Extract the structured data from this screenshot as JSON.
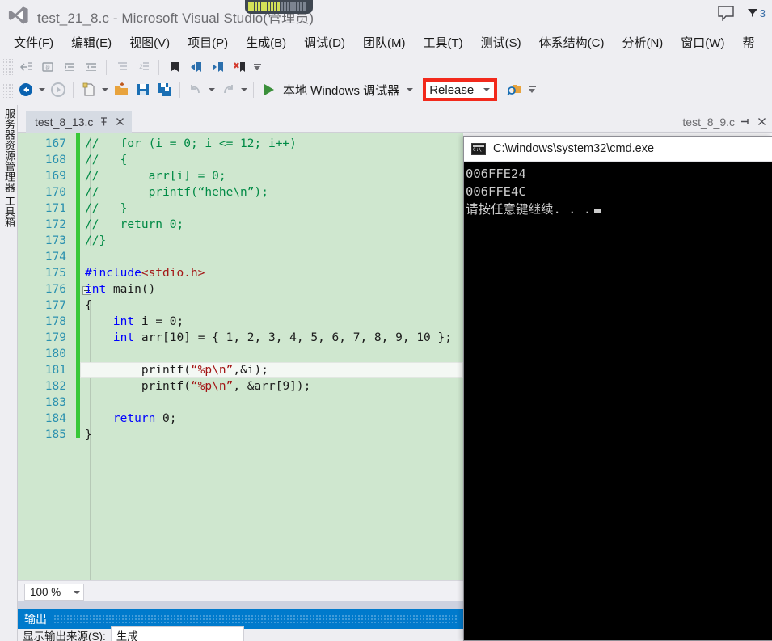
{
  "window": {
    "title": "test_21_8.c - Microsoft Visual Studio(管理员)",
    "logo_icon": "visual-studio-logo",
    "feedback_icon": "feedback-bubble-icon",
    "flag_icon": "flag-icon",
    "flag_count": "3"
  },
  "menubar": {
    "items": [
      {
        "label": "文件(F)"
      },
      {
        "label": "编辑(E)"
      },
      {
        "label": "视图(V)"
      },
      {
        "label": "项目(P)"
      },
      {
        "label": "生成(B)"
      },
      {
        "label": "调试(D)"
      },
      {
        "label": "团队(M)"
      },
      {
        "label": "工具(T)"
      },
      {
        "label": "测试(S)"
      },
      {
        "label": "体系结构(C)"
      },
      {
        "label": "分析(N)"
      },
      {
        "label": "窗口(W)"
      },
      {
        "label": "帮"
      }
    ]
  },
  "toolbar": {
    "run_label": "本地 Windows 调试器",
    "play_icon": "play-triangle-icon",
    "configuration": {
      "value": "Release",
      "highlight_color": "#f2291c"
    },
    "row1_icons": [
      "comment-selection-icon",
      "uncomment-selection-icon",
      "decrease-indent-icon",
      "increase-indent-icon",
      "format-block-icon",
      "format-selection-icon",
      "toggle-bookmark-icon",
      "previous-bookmark-icon",
      "next-bookmark-icon",
      "clear-bookmarks-icon"
    ],
    "row2_icons": [
      "navigate-backward-icon",
      "navigate-forward-icon",
      "new-project-icon",
      "open-file-icon",
      "save-icon",
      "save-all-icon",
      "undo-icon",
      "redo-icon"
    ],
    "search_icon": "find-in-files-icon",
    "overflow_icon": "toolbar-overflow-icon"
  },
  "leftdock": {
    "tabs": [
      {
        "label": "服务器资源管理器"
      },
      {
        "label": "工具箱"
      }
    ]
  },
  "tabstrip": {
    "active_tab": {
      "label": "test_8_13.c",
      "pin_icon": "pin-icon",
      "close_icon": "close-icon"
    },
    "right_tab": {
      "label": "test_8_9.c",
      "pin_icon": "pin-icon",
      "close_icon": "close-icon"
    }
  },
  "editor": {
    "zoom": "100 %",
    "current_line": 181,
    "lines": [
      {
        "n": "167",
        "tokens": [
          {
            "t": "//   for (i = 0; i <= 12; i++)",
            "c": "cm"
          }
        ]
      },
      {
        "n": "168",
        "tokens": [
          {
            "t": "//   {",
            "c": "cm"
          }
        ]
      },
      {
        "n": "169",
        "tokens": [
          {
            "t": "//       arr[i] = 0;",
            "c": "cm"
          }
        ]
      },
      {
        "n": "170",
        "tokens": [
          {
            "t": "//       printf(“hehe\\n”);",
            "c": "cm"
          }
        ]
      },
      {
        "n": "171",
        "tokens": [
          {
            "t": "//   }",
            "c": "cm"
          }
        ]
      },
      {
        "n": "172",
        "tokens": [
          {
            "t": "//   return 0;",
            "c": "cm"
          }
        ]
      },
      {
        "n": "173",
        "tokens": [
          {
            "t": "//}",
            "c": "cm"
          }
        ]
      },
      {
        "n": "174",
        "tokens": []
      },
      {
        "n": "175",
        "tokens": [
          {
            "t": "#include",
            "c": "pp"
          },
          {
            "t": "<stdio.h>",
            "c": "hdr"
          }
        ]
      },
      {
        "n": "176",
        "tokens": [
          {
            "t": "int",
            "c": "k"
          },
          {
            "t": " main()",
            "c": ""
          }
        ]
      },
      {
        "n": "177",
        "tokens": [
          {
            "t": "{",
            "c": ""
          }
        ]
      },
      {
        "n": "178",
        "tokens": [
          {
            "t": "    ",
            "c": ""
          },
          {
            "t": "int",
            "c": "k"
          },
          {
            "t": " i = 0;",
            "c": ""
          }
        ]
      },
      {
        "n": "179",
        "tokens": [
          {
            "t": "    ",
            "c": ""
          },
          {
            "t": "int",
            "c": "k"
          },
          {
            "t": " arr[10] = { 1, 2, 3, 4, 5, 6, 7, 8, 9, 10 };",
            "c": ""
          }
        ]
      },
      {
        "n": "180",
        "tokens": []
      },
      {
        "n": "181",
        "tokens": [
          {
            "t": "        printf(",
            "c": ""
          },
          {
            "t": "“%p\\n”",
            "c": "st"
          },
          {
            "t": ",&i);",
            "c": ""
          }
        ]
      },
      {
        "n": "182",
        "tokens": [
          {
            "t": "        printf(",
            "c": ""
          },
          {
            "t": "“%p\\n”",
            "c": "st"
          },
          {
            "t": ", &arr[9]);",
            "c": ""
          }
        ]
      },
      {
        "n": "183",
        "tokens": []
      },
      {
        "n": "184",
        "tokens": [
          {
            "t": "    ",
            "c": ""
          },
          {
            "t": "return",
            "c": "k"
          },
          {
            "t": " 0;",
            "c": ""
          }
        ]
      },
      {
        "n": "185",
        "tokens": [
          {
            "t": "}",
            "c": ""
          }
        ]
      }
    ]
  },
  "output": {
    "title": "输出",
    "source_label": "显示输出来源(S):",
    "source_value": "生成"
  },
  "cmd": {
    "title": "C:\\windows\\system32\\cmd.exe",
    "icon": "cmd-console-icon",
    "lines": [
      "006FFE24",
      "006FFE4C",
      "请按任意键继续. . ."
    ]
  }
}
